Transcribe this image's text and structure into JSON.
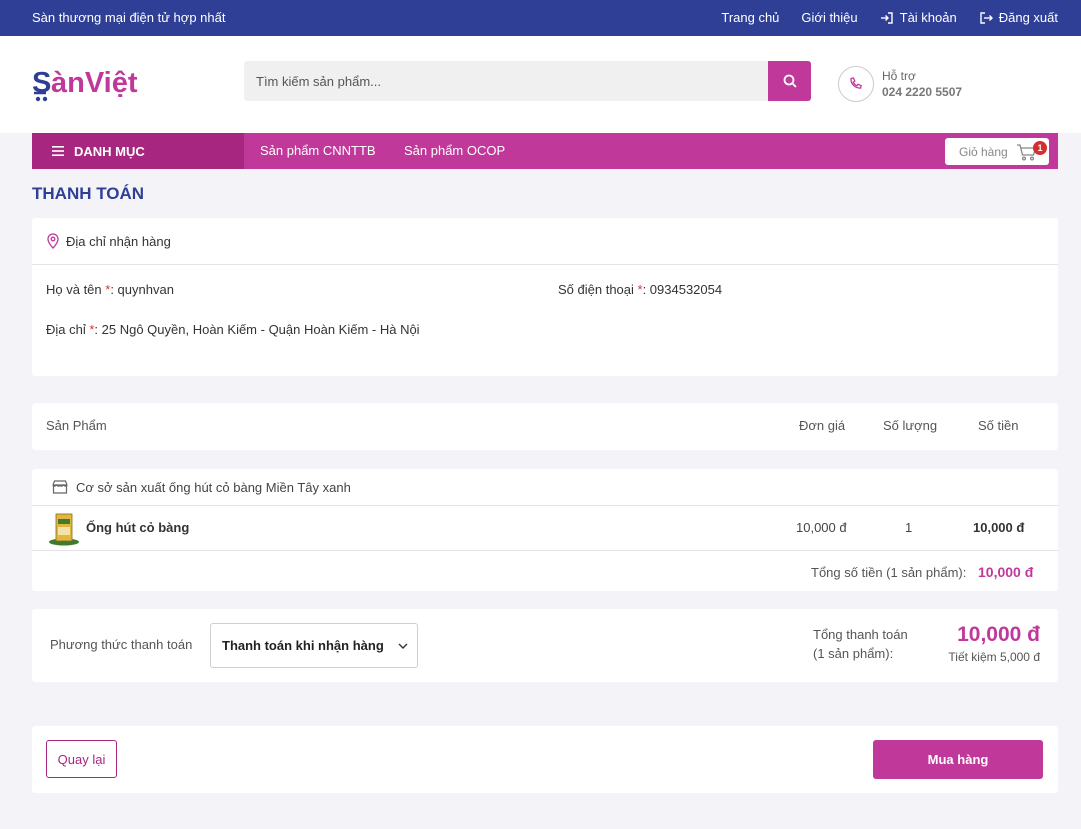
{
  "topbar": {
    "slogan": "Sàn thương mại điện tử hợp nhất",
    "links": [
      "Trang chủ",
      "Giới thiệu",
      "Tài khoản",
      "Đăng xuất"
    ]
  },
  "header": {
    "logo_text": "SànViệt",
    "search_placeholder": "Tìm kiếm sản phẩm...",
    "support_label": "Hỗ trợ",
    "support_phone": "024 2220 5507"
  },
  "nav": {
    "category_label": "DANH MỤC",
    "links": [
      "Sản phẩm CNNTTB",
      "Sản phẩm OCOP"
    ],
    "cart_label": "Giỏ hàng",
    "cart_count": "1"
  },
  "page_title": "THANH TOÁN",
  "address": {
    "header": "Địa chỉ nhận hàng",
    "name_label": "Họ và tên ",
    "name_value": ": quynhvan",
    "phone_label": "Số điện thoại ",
    "phone_value": ": 0934532054",
    "addr_label": "Địa chỉ ",
    "addr_value": ": 25 Ngô Quyền, Hoàn Kiếm - Quận Hoàn Kiếm - Hà Nội",
    "required_mark": "*"
  },
  "table": {
    "headers": [
      "Sản Phẩm",
      "Đơn giá",
      "Số lượng",
      "Số tiền"
    ]
  },
  "order": {
    "shop_name": "Cơ sở sản xuất ống hút cỏ bàng Miền Tây xanh",
    "product_name": "Ống hút cỏ bàng",
    "unit_price": "10,000 đ",
    "quantity": "1",
    "line_total": "10,000 đ",
    "total_label": "Tổng số tiền (1 sản phẩm):",
    "total_value": "10,000 đ"
  },
  "payment": {
    "method_label": "Phương thức thanh toán",
    "method_selected": "Thanh toán khi nhận hàng",
    "grand_label_1": "Tổng thanh toán",
    "grand_label_2": "(1 sản phẩm):",
    "grand_value": "10,000 đ",
    "savings": "Tiết kiệm 5,000 đ"
  },
  "actions": {
    "back": "Quay lại",
    "buy": "Mua hàng"
  },
  "colors": {
    "brand_blue": "#2e3f95",
    "brand_pink": "#c0399a",
    "category_dark_pink": "#a7267f"
  }
}
